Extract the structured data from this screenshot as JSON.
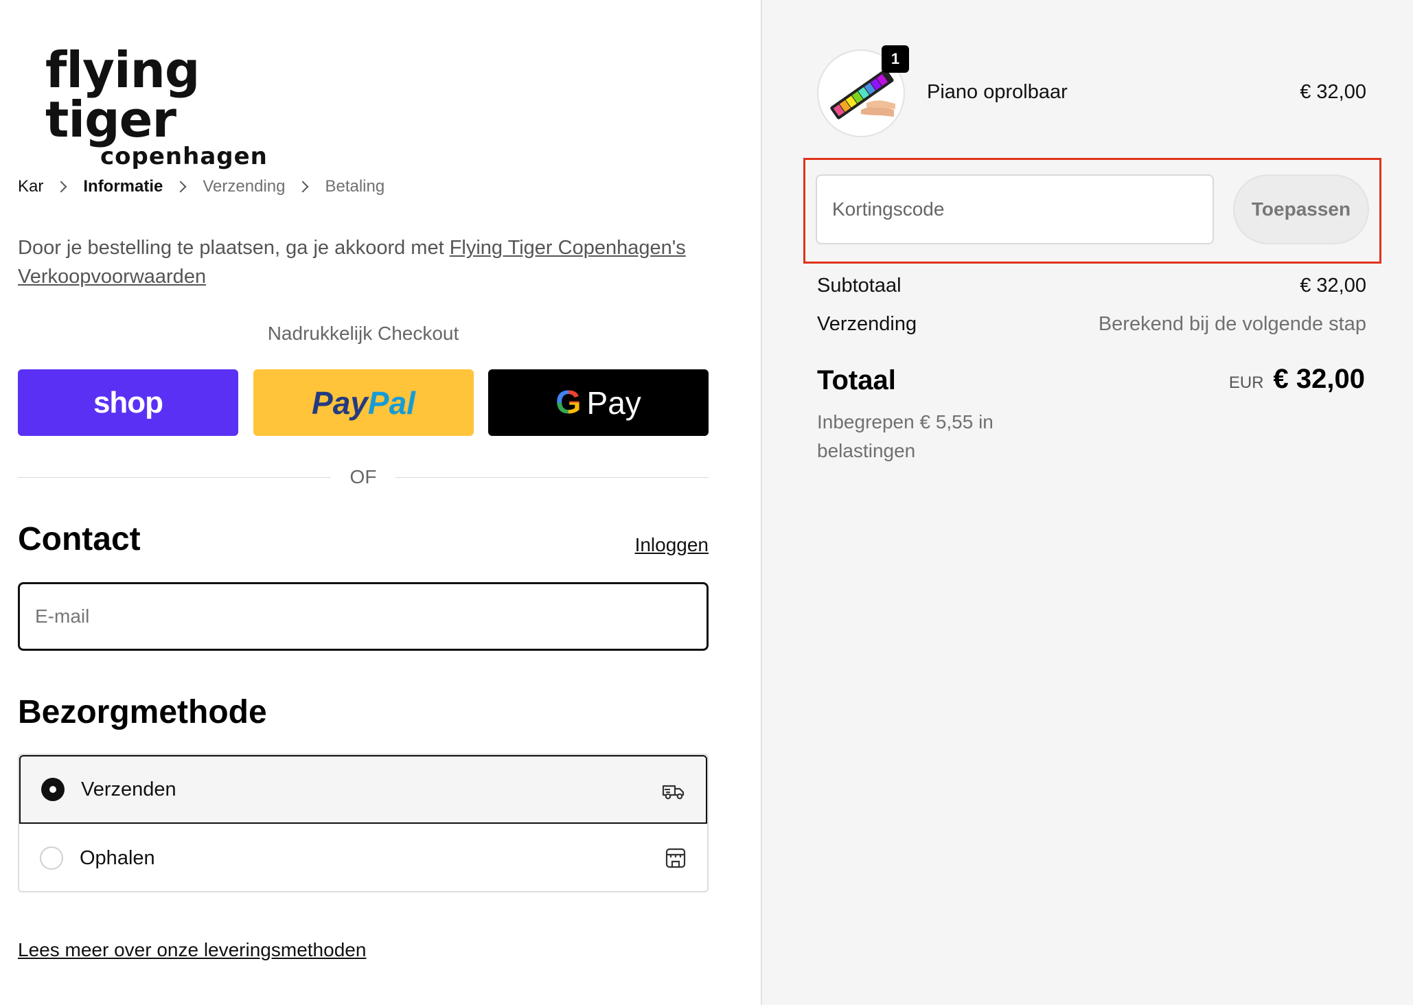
{
  "brand": {
    "logo_line1": "flying tiger",
    "logo_line2": "copenhagen"
  },
  "breadcrumb": [
    {
      "label": "Kar",
      "state": "link"
    },
    {
      "label": "Informatie",
      "state": "active"
    },
    {
      "label": "Verzending",
      "state": "muted"
    },
    {
      "label": "Betaling",
      "state": "muted"
    }
  ],
  "terms": {
    "prefix": "Door je bestelling te plaatsen, ga je akkoord met ",
    "link": "Flying Tiger Copenhagen's Verkoopvoorwaarden"
  },
  "express": {
    "title": "Nadrukkelijk Checkout",
    "shop_label": "shop",
    "paypal_part1": "Pay",
    "paypal_part2": "Pal",
    "gpay_g": "G",
    "gpay_label": "Pay"
  },
  "divider_text": "OF",
  "contact": {
    "heading": "Contact",
    "login_link": "Inloggen",
    "email_placeholder": "E-mail",
    "email_value": ""
  },
  "delivery": {
    "heading": "Bezorgmethode",
    "options": [
      {
        "label": "Verzenden",
        "selected": true,
        "icon": "truck-icon"
      },
      {
        "label": "Ophalen",
        "selected": false,
        "icon": "store-icon"
      }
    ],
    "learn_more": "Lees meer over onze leveringsmethoden"
  },
  "summary": {
    "product": {
      "name": "Piano oprolbaar",
      "price": "€ 32,00",
      "quantity": "1"
    },
    "discount": {
      "placeholder": "Kortingscode",
      "apply_label": "Toepassen"
    },
    "subtotal_label": "Subtotaal",
    "subtotal_value": "€ 32,00",
    "shipping_label": "Verzending",
    "shipping_value": "Berekend bij de volgende stap",
    "total_label": "Totaal",
    "total_currency": "EUR",
    "total_value": "€ 32,00",
    "tax_note": "Inbegrepen € 5,55 in belastingen"
  },
  "colors": {
    "shop_purple": "#5a31f4",
    "paypal_yellow": "#ffc439",
    "gpay_black": "#000000",
    "highlight_red": "#e0321c",
    "summary_bg": "#f5f5f5"
  }
}
